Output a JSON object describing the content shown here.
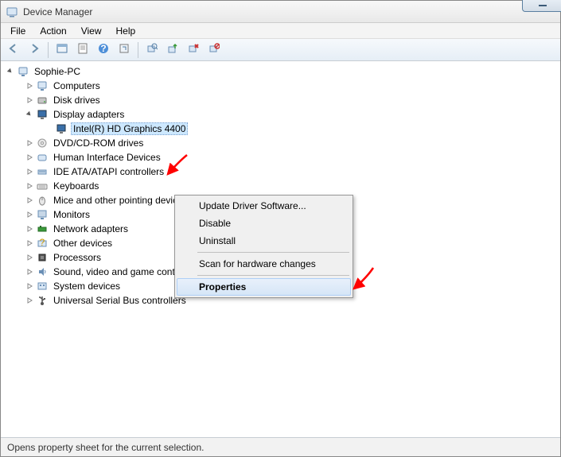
{
  "window": {
    "title": "Device Manager"
  },
  "menus": {
    "file": "File",
    "action": "Action",
    "view": "View",
    "help": "Help"
  },
  "toolbar_icons": [
    "back",
    "forward",
    "_sep",
    "show-console",
    "properties-sheet",
    "help",
    "refresh",
    "_sep",
    "scan-hardware",
    "update-driver",
    "uninstall",
    "disable"
  ],
  "tree": {
    "root": "Sophie-PC",
    "nodes": [
      {
        "label": "Computers",
        "icon": "computer"
      },
      {
        "label": "Disk drives",
        "icon": "disk"
      },
      {
        "label": "Display adapters",
        "icon": "display",
        "expanded": true,
        "children": [
          {
            "label": "Intel(R) HD Graphics 4400",
            "icon": "display",
            "selected": true
          }
        ]
      },
      {
        "label": "DVD/CD-ROM drives",
        "icon": "cdrom"
      },
      {
        "label": "Human Interface Devices",
        "icon": "hid"
      },
      {
        "label": "IDE ATA/ATAPI controllers",
        "icon": "ide"
      },
      {
        "label": "Keyboards",
        "icon": "keyboard"
      },
      {
        "label": "Mice and other pointing devices",
        "icon": "mouse"
      },
      {
        "label": "Monitors",
        "icon": "monitor"
      },
      {
        "label": "Network adapters",
        "icon": "network"
      },
      {
        "label": "Other devices",
        "icon": "other"
      },
      {
        "label": "Processors",
        "icon": "cpu"
      },
      {
        "label": "Sound, video and game controllers",
        "icon": "sound"
      },
      {
        "label": "System devices",
        "icon": "system"
      },
      {
        "label": "Universal Serial Bus controllers",
        "icon": "usb"
      }
    ]
  },
  "context_menu": {
    "items": [
      {
        "label": "Update Driver Software...",
        "type": "item"
      },
      {
        "label": "Disable",
        "type": "item"
      },
      {
        "label": "Uninstall",
        "type": "item"
      },
      {
        "type": "sep"
      },
      {
        "label": "Scan for hardware changes",
        "type": "item"
      },
      {
        "type": "sep"
      },
      {
        "label": "Properties",
        "type": "item",
        "hover": true
      }
    ]
  },
  "status": "Opens property sheet for the current selection.",
  "annotation_color": "#ff0000"
}
